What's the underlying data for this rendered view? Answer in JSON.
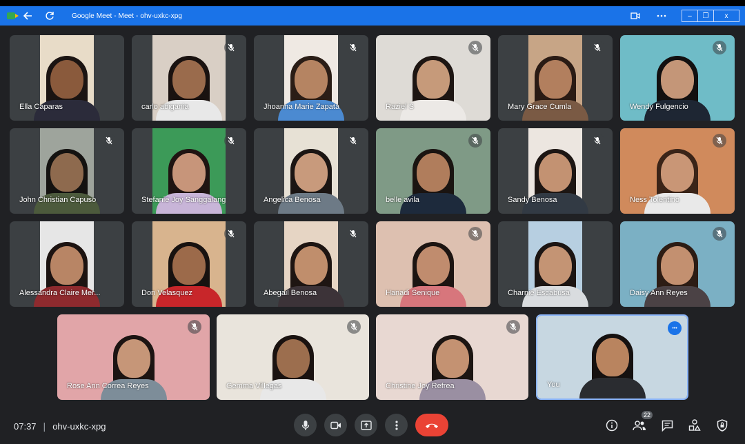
{
  "browser": {
    "title": "Google Meet - Meet - ohv-uxkc-xpg",
    "window_controls": [
      "–",
      "❐",
      "x"
    ]
  },
  "participants": [
    {
      "name": "Ella Caparas",
      "muted": false,
      "bg": "#e8dcc8",
      "skin": "#8a5a3c",
      "hair": "#1b1412",
      "shirt": "#2b2b3a"
    },
    {
      "name": "carlo abigania",
      "muted": true,
      "bg": "#d9cfc5",
      "skin": "#9a6b4c",
      "hair": "#1a1210",
      "shirt": "#e8e8e8"
    },
    {
      "name": "Jhoanna Marie Zapata",
      "muted": true,
      "bg": "#efe9e3",
      "skin": "#b58462",
      "hair": "#2a1d16",
      "shirt": "#4b8ad1"
    },
    {
      "name": "Raziel S",
      "muted": true,
      "bg": "#dedbd6",
      "skin": "#c69a7a",
      "hair": "#1d1512",
      "shirt": "#ece9e6"
    },
    {
      "name": "Mary Grace Cumla",
      "muted": true,
      "bg": "#c7a586",
      "skin": "#b27f5e",
      "hair": "#2a1b14",
      "shirt": "#7a5a44"
    },
    {
      "name": "Wendy Fulgencio",
      "muted": true,
      "bg": "#6fbcc7",
      "skin": "#c49678",
      "hair": "#121010",
      "shirt": "#1e2633"
    },
    {
      "name": "John Christian Capuso",
      "muted": true,
      "bg": "#9ea49c",
      "skin": "#8e6a4e",
      "hair": "#141210",
      "shirt": "#4c5a3c"
    },
    {
      "name": "Stefanie Joy Sanggalang",
      "muted": true,
      "bg": "#3c9a58",
      "skin": "#c7957a",
      "hair": "#1f1412",
      "shirt": "#c8b5d8"
    },
    {
      "name": "Angelica Benosa",
      "muted": true,
      "bg": "#e7e1d5",
      "skin": "#c89a7c",
      "hair": "#1b1513",
      "shirt": "#6d7a86"
    },
    {
      "name": "belle avila",
      "muted": true,
      "bg": "#7f9a86",
      "skin": "#b07d5c",
      "hair": "#1a1411",
      "shirt": "#1d2a3c"
    },
    {
      "name": "Sandy Benosa",
      "muted": true,
      "bg": "#ece6e0",
      "skin": "#c39272",
      "hair": "#1d1613",
      "shirt": "#323a44"
    },
    {
      "name": "Ness Tolentino",
      "muted": true,
      "bg": "#d08a5c",
      "skin": "#c99676",
      "hair": "#3a2418",
      "shirt": "#e9e9e9"
    },
    {
      "name": "Alessandra Claire Mer...",
      "muted": false,
      "bg": "#e6e6e6",
      "skin": "#b88565",
      "hair": "#1c1311",
      "shirt": "#8e2a2e"
    },
    {
      "name": "Don Velasquez",
      "muted": true,
      "bg": "#d8b48e",
      "skin": "#9c6a4a",
      "hair": "#181210",
      "shirt": "#c8262a"
    },
    {
      "name": "Abegail Benosa",
      "muted": true,
      "bg": "#e6d5c4",
      "skin": "#c08e6c",
      "hair": "#1e1512",
      "shirt": "#3c3338"
    },
    {
      "name": "Hanadi Senique",
      "muted": true,
      "bg": "#ddc0b0",
      "skin": "#c08c6e",
      "hair": "#1c1411",
      "shirt": "#d7767c"
    },
    {
      "name": "Charnie Escabusa",
      "muted": false,
      "bg": "#b7cfe1",
      "skin": "#c49474",
      "hair": "#1c1513",
      "shirt": "#d9dcdf"
    },
    {
      "name": "Daisy Ann Reyes",
      "muted": true,
      "bg": "#7bb0c4",
      "skin": "#c39070",
      "hair": "#2c1c14",
      "shirt": "#4b4245"
    },
    {
      "name": "Rose Ann Correa Reyes",
      "muted": true,
      "bg": "#e1a5a8",
      "skin": "#c69678",
      "hair": "#1c1412",
      "shirt": "#7d8d99"
    },
    {
      "name": "Gemma Villegas",
      "muted": true,
      "bg": "#e9e4dc",
      "skin": "#9c6e4e",
      "hair": "#1a1210",
      "shirt": "#e8e8e8"
    },
    {
      "name": "Christine Joy Refrea",
      "muted": true,
      "bg": "#e8d8d2",
      "skin": "#c49272",
      "hair": "#1c1512",
      "shirt": "#9a8fa2"
    },
    {
      "name": "You",
      "muted": false,
      "self": true,
      "bg": "#c7d7e1",
      "skin": "#b9845f",
      "hair": "#151110",
      "shirt": "#2a2c30"
    }
  ],
  "bottom": {
    "time": "07:37",
    "meeting_code": "ohv-uxkc-xpg",
    "people_count": "22"
  },
  "colors": {
    "titlebar": "#1a73e8",
    "background": "#202124",
    "end_call": "#ea4335",
    "button_bg": "#3c4043"
  }
}
